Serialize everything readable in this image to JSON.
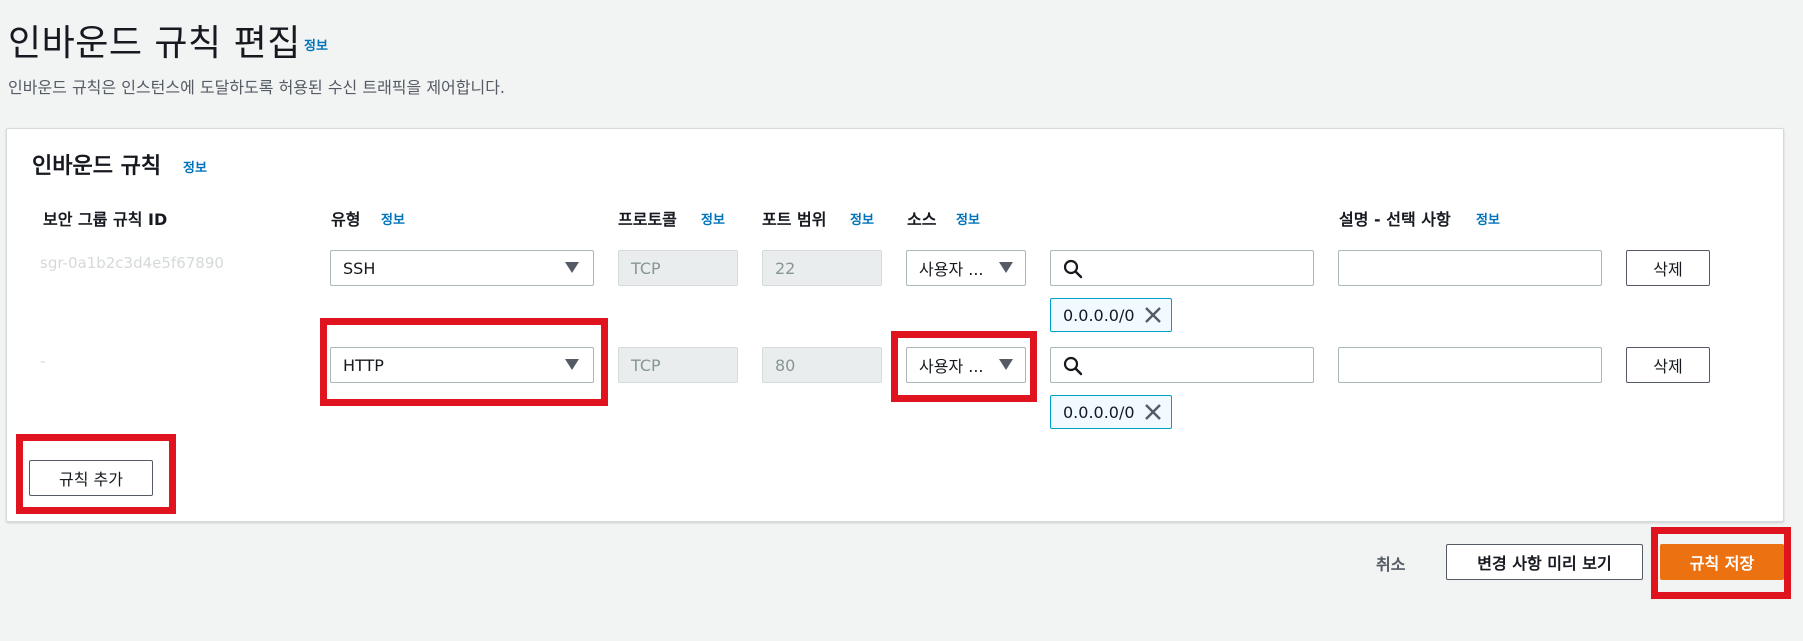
{
  "header": {
    "title": "인바운드 규칙 편집",
    "info": "정보",
    "description": "인바운드 규칙은 인스턴스에 도달하도록 허용된 수신 트래픽을 제어합니다."
  },
  "panel": {
    "title": "인바운드 규칙",
    "info": "정보"
  },
  "columns": {
    "rule_id": "보안 그룹 규칙 ID",
    "type": "유형",
    "type_info": "정보",
    "protocol": "프로토콜",
    "protocol_info": "정보",
    "port_range": "포트 범위",
    "port_info": "정보",
    "source": "소스",
    "source_info": "정보",
    "description": "설명 - 선택 사항",
    "description_info": "정보"
  },
  "rules": [
    {
      "rule_id": "sgr-0a1b2c3d4e5f67890",
      "type": "SSH",
      "protocol": "TCP",
      "port": "22",
      "source": "사용자 ...",
      "cidr": "0.0.0.0/0",
      "delete_label": "삭제"
    },
    {
      "rule_id": "-",
      "type": "HTTP",
      "protocol": "TCP",
      "port": "80",
      "source": "사용자 ...",
      "cidr": "0.0.0.0/0",
      "delete_label": "삭제"
    }
  ],
  "actions": {
    "add_rule": "규칙 추가",
    "cancel": "취소",
    "preview": "변경 사항 미리 보기",
    "save": "규칙 저장"
  },
  "colors": {
    "primary": "#ec7211",
    "link": "#0073bb",
    "highlight": "#e0141e",
    "token_border": "#00a1c9"
  }
}
